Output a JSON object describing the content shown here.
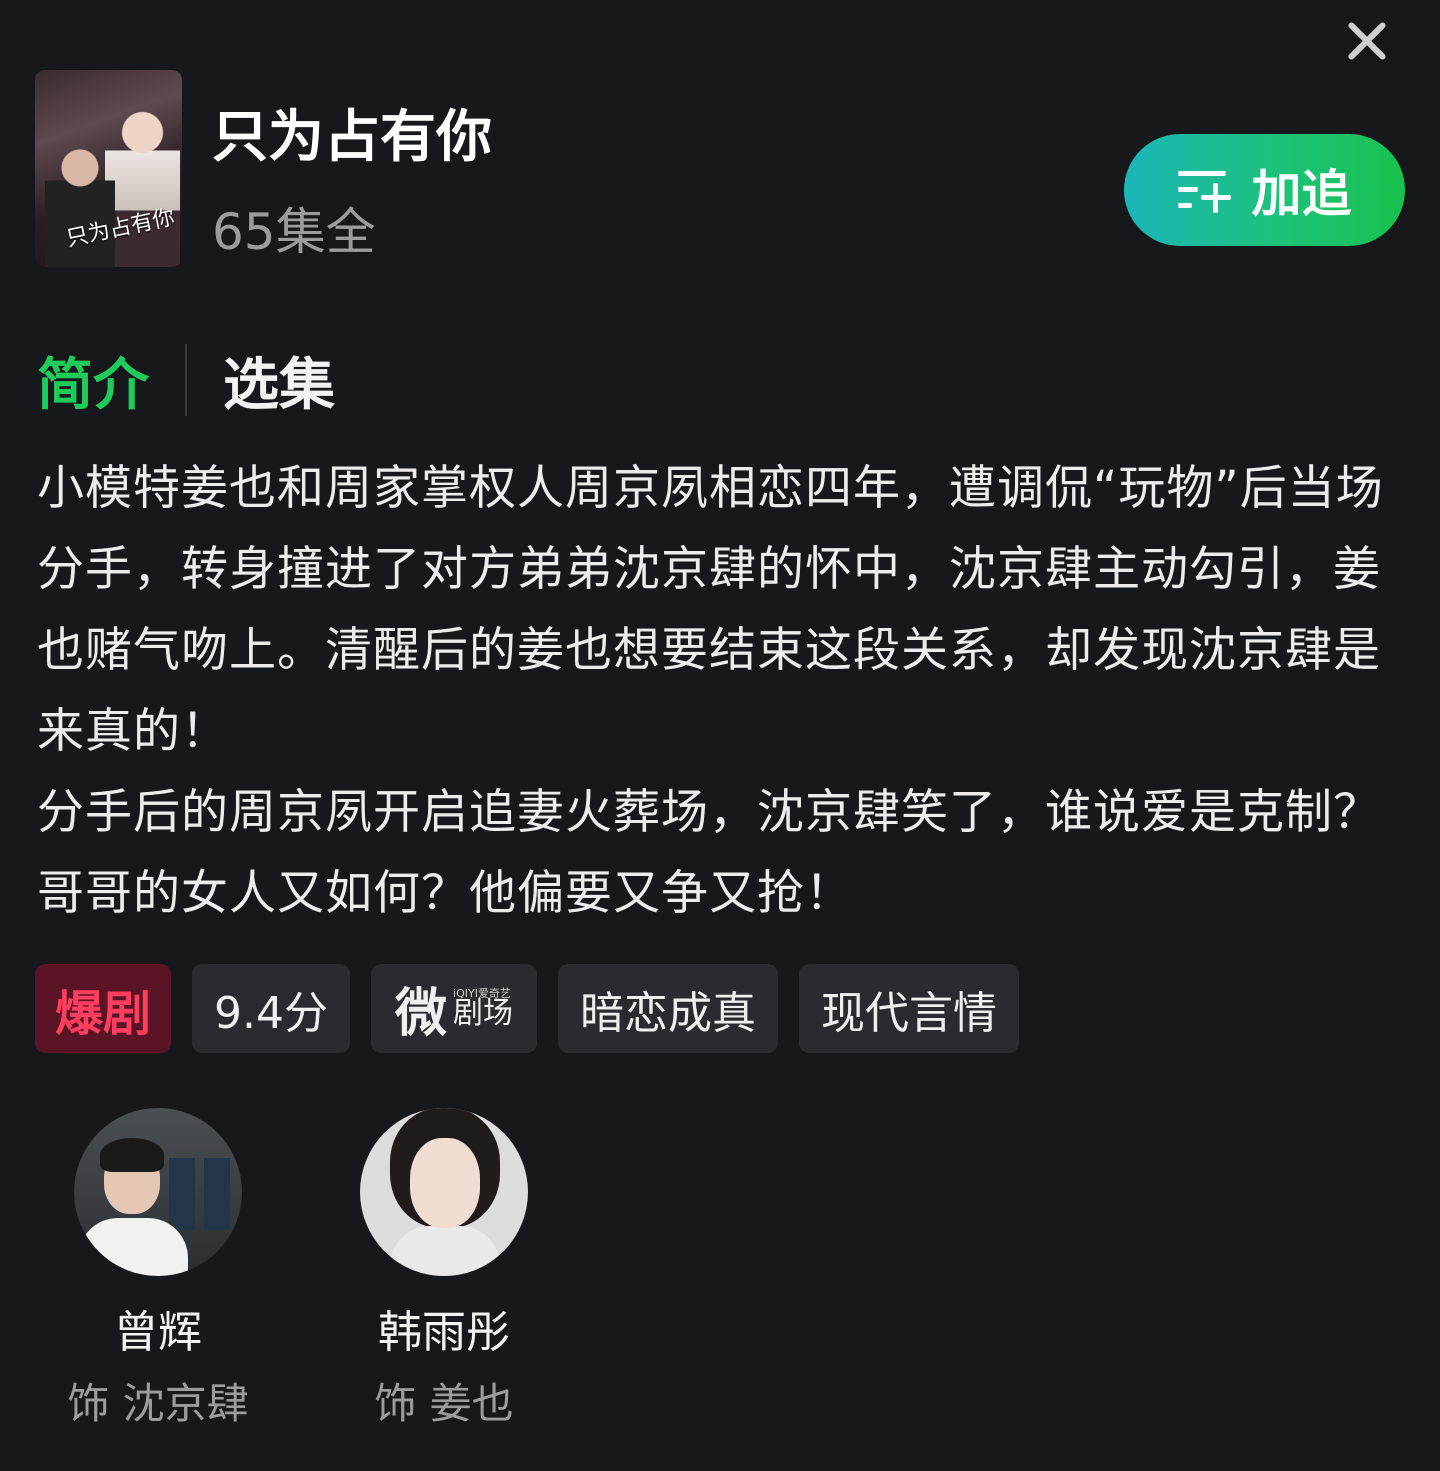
{
  "header": {
    "title": "只为占有你",
    "episodes": "65集全",
    "follow_label": "加追",
    "poster_text": "只为占有你"
  },
  "tabs": [
    {
      "label": "简介",
      "active": true
    },
    {
      "label": "选集",
      "active": false
    }
  ],
  "synopsis": {
    "para1": "小模特姜也和周家掌权人周京夙相恋四年，遭调侃“玩物”后当场分手，转身撞进了对方弟弟沈京肆的怀中，沈京肆主动勾引，姜也赌气吻上。清醒后的姜也想要结束这段关系，却发现沈京肆是来真的！",
    "para2": "分手后的周京夙开启追妻火葬场，沈京肆笑了，谁说爱是克制？哥哥的女人又如何？他偏要又争又抢！"
  },
  "tags": {
    "hot": "爆剧",
    "score": "9.4分",
    "platform_big": "微",
    "platform_small": "iQIYI爱奇艺",
    "platform_mid": "剧场",
    "tag1": "暗恋成真",
    "tag2": "现代言情"
  },
  "cast": [
    {
      "name": "曾辉",
      "role": "饰 沈京肆"
    },
    {
      "name": "韩雨彤",
      "role": "饰 姜也"
    }
  ],
  "colors": {
    "background": "#17181c",
    "accent_green": "#1fcb5a",
    "hot_tag": "#ff3d5e"
  }
}
